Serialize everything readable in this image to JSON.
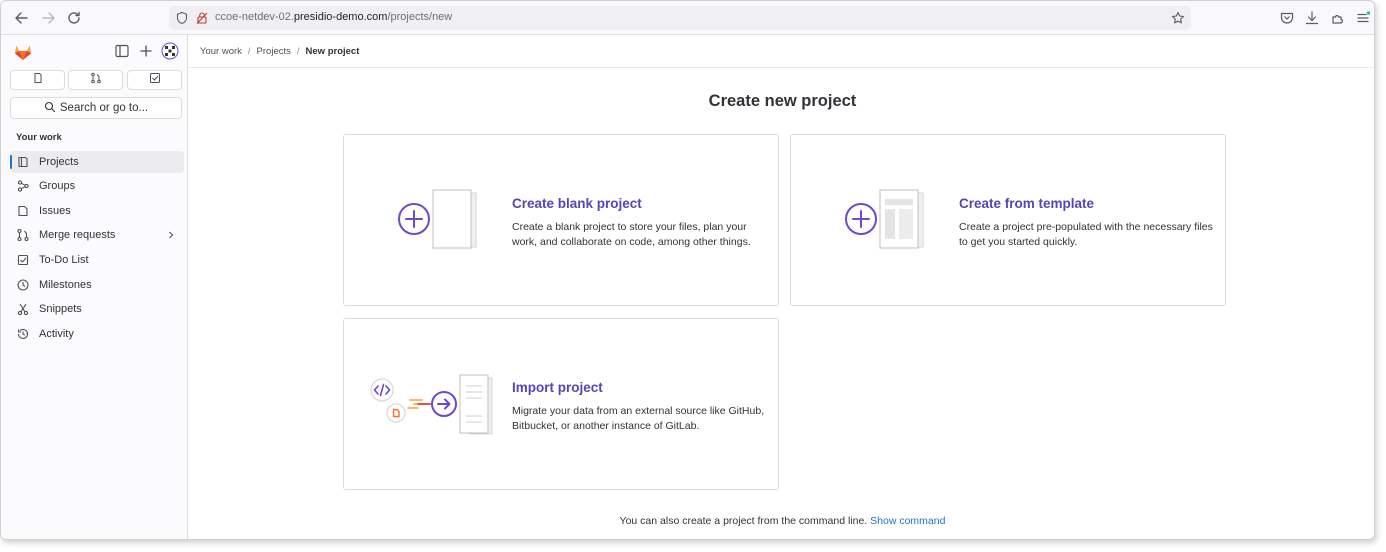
{
  "browser": {
    "url_prefix": "ccoe-netdev-02.",
    "url_domain": "presidio-demo.com",
    "url_path": "/projects/new"
  },
  "sidebar": {
    "search_label": "Search or go to...",
    "heading": "Your work",
    "items": [
      {
        "label": "Projects",
        "icon": "project-icon",
        "active": true
      },
      {
        "label": "Groups",
        "icon": "group-icon"
      },
      {
        "label": "Issues",
        "icon": "issues-icon"
      },
      {
        "label": "Merge requests",
        "icon": "merge-request-icon",
        "has_submenu": true
      },
      {
        "label": "To-Do List",
        "icon": "todo-icon"
      },
      {
        "label": "Milestones",
        "icon": "milestone-icon"
      },
      {
        "label": "Snippets",
        "icon": "snippet-icon"
      },
      {
        "label": "Activity",
        "icon": "activity-icon"
      }
    ]
  },
  "breadcrumb": {
    "items": [
      "Your work",
      "Projects",
      "New project"
    ]
  },
  "main": {
    "title": "Create new project",
    "cards": [
      {
        "title": "Create blank project",
        "description": "Create a blank project to store your files, plan your work, and collaborate on code, among other things."
      },
      {
        "title": "Create from template",
        "description": "Create a project pre-populated with the necessary files to get you started quickly."
      },
      {
        "title": "Import project",
        "description": "Migrate your data from an external source like GitHub, Bitbucket, or another instance of GitLab."
      }
    ],
    "cli_text": "You can also create a project from the command line.",
    "cli_link": "Show command"
  },
  "colors": {
    "accent_purple": "#5943b6",
    "link_blue": "#1f75cb",
    "gitlab_orange": "#e24329"
  }
}
